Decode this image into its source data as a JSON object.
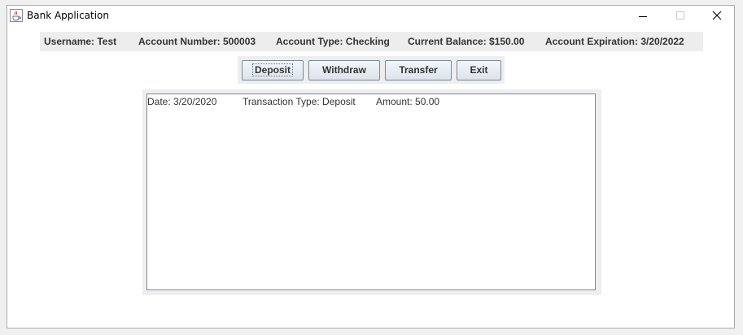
{
  "window": {
    "title": "Bank Application"
  },
  "account_info": {
    "username": "Username: Test",
    "account_number": "Account Number: 500003",
    "account_type": "Account Type: Checking",
    "current_balance": "Current Balance: $150.00",
    "account_expiration": "Account Expiration: 3/20/2022"
  },
  "buttons": {
    "deposit": "Deposit",
    "withdraw": "Withdraw",
    "transfer": "Transfer",
    "exit": "Exit"
  },
  "transactions": [
    {
      "date": "Date: 3/20/2020",
      "type": "Transaction Type: Deposit",
      "amount": "Amount: 50.00"
    }
  ],
  "icons": {
    "app": "java-cup-icon",
    "minimize": "minimize-icon",
    "maximize": "maximize-icon",
    "close": "close-icon"
  }
}
